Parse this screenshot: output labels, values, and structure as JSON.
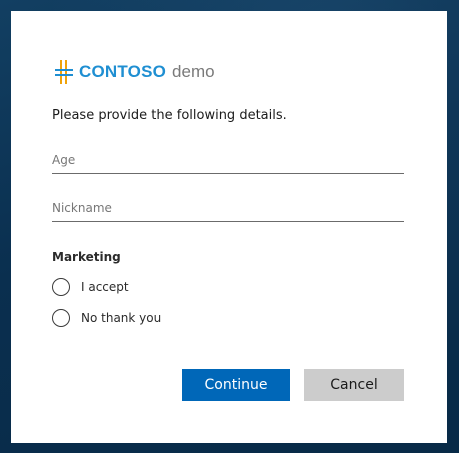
{
  "brand": {
    "name": "CONTOSO",
    "suffix": "demo",
    "icon": "contoso-logo-icon",
    "color": "#1f8fd2"
  },
  "form": {
    "intro": "Please provide the following details.",
    "fields": {
      "age": {
        "placeholder": "Age",
        "value": ""
      },
      "nickname": {
        "placeholder": "Nickname",
        "value": ""
      }
    },
    "marketing": {
      "label": "Marketing",
      "options": [
        {
          "label": "I accept",
          "selected": false
        },
        {
          "label": "No thank you",
          "selected": false
        }
      ]
    }
  },
  "actions": {
    "continue_label": "Continue",
    "cancel_label": "Cancel",
    "primary_color": "#0067b8",
    "secondary_color": "#cccccc"
  }
}
